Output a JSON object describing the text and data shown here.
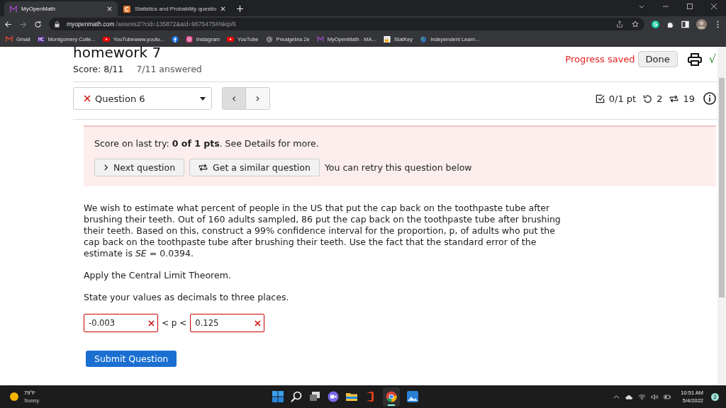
{
  "browser": {
    "tabs": [
      {
        "title": "MyOpenMath",
        "selected": true
      },
      {
        "title": "Statistics and Probability questio",
        "selected": false
      }
    ],
    "url_host": "myopenmath.com",
    "url_path": "/assess2/?cid=135872&aid=9675475#/skip/6",
    "bookmarks": [
      {
        "kind": "labeled",
        "label": "Gmail"
      },
      {
        "kind": "labeled",
        "label": "Montgomery Colle..."
      },
      {
        "kind": "labeled",
        "label": "YouTubewww.youtu..."
      },
      {
        "kind": "icon"
      },
      {
        "kind": "labeled",
        "label": "Instagram"
      },
      {
        "kind": "labeled",
        "label": "YouTube"
      },
      {
        "kind": "labeled",
        "label": "Prealgebra 2e"
      },
      {
        "kind": "labeled",
        "label": "MyOpenMath - MA..."
      },
      {
        "kind": "labeled",
        "label": "StatKey"
      },
      {
        "kind": "labeled",
        "label": "Independent Learn..."
      }
    ]
  },
  "page": {
    "title": "homework 7",
    "score": "Score: 8/11",
    "answered": "7/11 answered",
    "progress": "Progress saved",
    "done": "Done",
    "check_mark": "√",
    "question_select": {
      "value": "Question 6",
      "correct": false
    },
    "prev": "‹",
    "next": "›",
    "points": "0/1 pt",
    "retries": "2",
    "versions": "19",
    "feedback": {
      "text": "Score on last try: **0 of 1 pts**. See Details for more.",
      "next_button": "Next question",
      "similar_button": "Get a similar question",
      "retry_note": "You can retry this question below"
    },
    "question": [
      "We wish to estimate what percent of people in the US that put the cap back on the toothpaste tube after brushing their teeth. Out of 160 adults sampled, 86 put the cap back on the toothpaste tube after brushing their teeth. Based on this, construct a 99% confidence interval for the proportion, p, of adults who put the cap back on the toothpaste tube after brushing their teeth. Use the fact that the standard error of the estimate is *SE* = 0.0394.",
      "Apply the Central Limit Theorem.",
      "State your values as decimals to three places."
    ],
    "answers": [
      {
        "value": "-0.003",
        "correct": false
      },
      {
        "value": "0.125",
        "correct": false
      }
    ],
    "between": "< p <",
    "submit": "Submit Question"
  },
  "taskbar": {
    "temp": "79°F",
    "weather": "Sunny",
    "time": "10:51 AM",
    "date": "5/4/2022",
    "notifications": "2"
  }
}
